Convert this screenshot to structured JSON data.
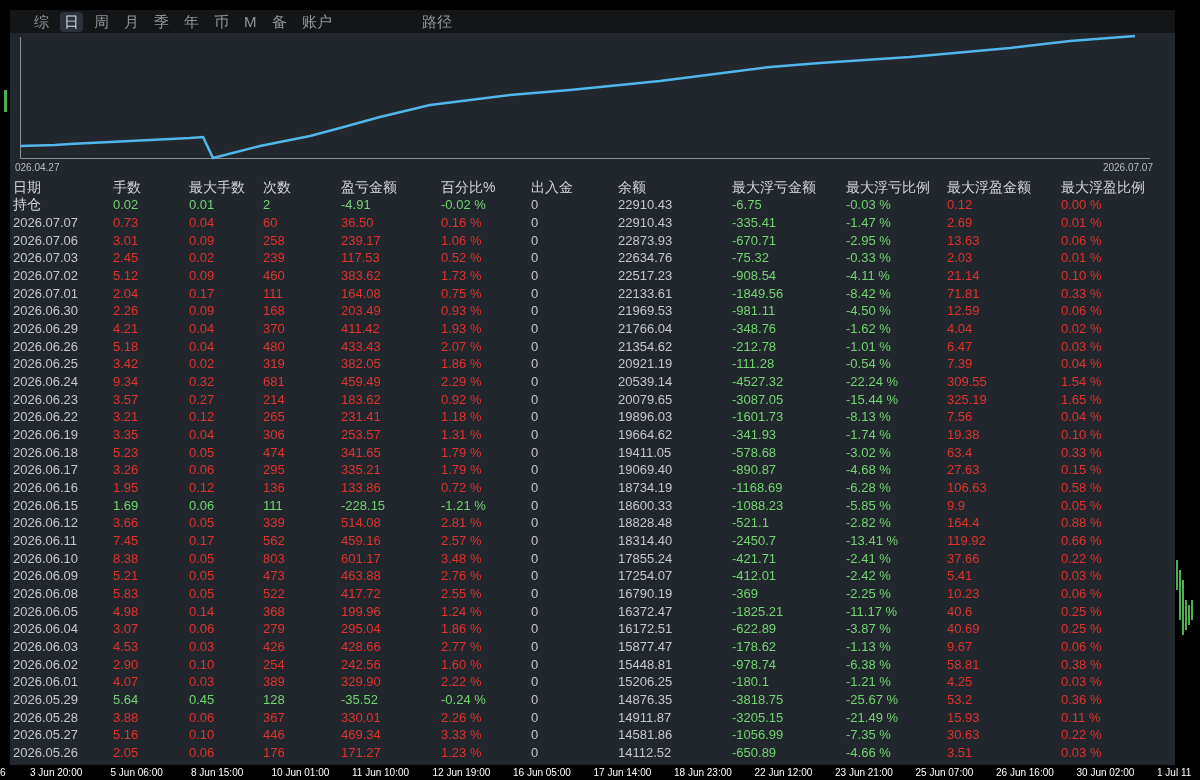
{
  "tabs": [
    {
      "label": "综",
      "selected": false
    },
    {
      "label": "日",
      "selected": true
    },
    {
      "label": "周",
      "selected": false
    },
    {
      "label": "月",
      "selected": false
    },
    {
      "label": "季",
      "selected": false
    },
    {
      "label": "年",
      "selected": false
    },
    {
      "label": "币",
      "selected": false
    },
    {
      "label": "M",
      "selected": false
    },
    {
      "label": "备",
      "selected": false
    },
    {
      "label": "账户",
      "selected": false
    }
  ],
  "path_button": "路径",
  "equity_chart": {
    "start_label": "026.04.27",
    "end_label": "2026.07.07"
  },
  "table": {
    "columns": [
      "日期",
      "手数",
      "最大手数",
      "次数",
      "盈亏金额",
      "百分比%",
      "出入金",
      "余额",
      "最大浮亏金额",
      "最大浮亏比例",
      "最大浮盈金额",
      "最大浮盈比例"
    ],
    "rows": [
      {
        "loss": true,
        "cells": [
          "持仓",
          "0.02",
          "0.01",
          "2",
          "-4.91",
          "-0.02 %",
          "0",
          "22910.43",
          "-6.75",
          "-0.03 %",
          "0.12",
          "0.00 %"
        ]
      },
      {
        "loss": false,
        "cells": [
          "2026.07.07",
          "0.73",
          "0.04",
          "60",
          "36.50",
          "0.16 %",
          "0",
          "22910.43",
          "-335.41",
          "-1.47 %",
          "2.69",
          "0.01 %"
        ]
      },
      {
        "loss": false,
        "cells": [
          "2026.07.06",
          "3.01",
          "0.09",
          "258",
          "239.17",
          "1.06 %",
          "0",
          "22873.93",
          "-670.71",
          "-2.95 %",
          "13.63",
          "0.06 %"
        ]
      },
      {
        "loss": false,
        "cells": [
          "2026.07.03",
          "2.45",
          "0.02",
          "239",
          "117.53",
          "0.52 %",
          "0",
          "22634.76",
          "-75.32",
          "-0.33 %",
          "2.03",
          "0.01 %"
        ]
      },
      {
        "loss": false,
        "cells": [
          "2026.07.02",
          "5.12",
          "0.09",
          "460",
          "383.62",
          "1.73 %",
          "0",
          "22517.23",
          "-908.54",
          "-4.11 %",
          "21.14",
          "0.10 %"
        ]
      },
      {
        "loss": false,
        "cells": [
          "2026.07.01",
          "2.04",
          "0.17",
          "111",
          "164.08",
          "0.75 %",
          "0",
          "22133.61",
          "-1849.56",
          "-8.42 %",
          "71.81",
          "0.33 %"
        ]
      },
      {
        "loss": false,
        "cells": [
          "2026.06.30",
          "2.26",
          "0.09",
          "168",
          "203.49",
          "0.93 %",
          "0",
          "21969.53",
          "-981.11",
          "-4.50 %",
          "12.59",
          "0.06 %"
        ]
      },
      {
        "loss": false,
        "cells": [
          "2026.06.29",
          "4.21",
          "0.04",
          "370",
          "411.42",
          "1.93 %",
          "0",
          "21766.04",
          "-348.76",
          "-1.62 %",
          "4.04",
          "0.02 %"
        ]
      },
      {
        "loss": false,
        "cells": [
          "2026.06.26",
          "5.18",
          "0.04",
          "480",
          "433.43",
          "2.07 %",
          "0",
          "21354.62",
          "-212.78",
          "-1.01 %",
          "6.47",
          "0.03 %"
        ]
      },
      {
        "loss": false,
        "cells": [
          "2026.06.25",
          "3.42",
          "0.02",
          "319",
          "382.05",
          "1.86 %",
          "0",
          "20921.19",
          "-111.28",
          "-0.54 %",
          "7.39",
          "0.04 %"
        ]
      },
      {
        "loss": false,
        "cells": [
          "2026.06.24",
          "9.34",
          "0.32",
          "681",
          "459.49",
          "2.29 %",
          "0",
          "20539.14",
          "-4527.32",
          "-22.24 %",
          "309.55",
          "1.54 %"
        ]
      },
      {
        "loss": false,
        "cells": [
          "2026.06.23",
          "3.57",
          "0.27",
          "214",
          "183.62",
          "0.92 %",
          "0",
          "20079.65",
          "-3087.05",
          "-15.44 %",
          "325.19",
          "1.65 %"
        ]
      },
      {
        "loss": false,
        "cells": [
          "2026.06.22",
          "3.21",
          "0.12",
          "265",
          "231.41",
          "1.18 %",
          "0",
          "19896.03",
          "-1601.73",
          "-8.13 %",
          "7.56",
          "0.04 %"
        ]
      },
      {
        "loss": false,
        "cells": [
          "2026.06.19",
          "3.35",
          "0.04",
          "306",
          "253.57",
          "1.31 %",
          "0",
          "19664.62",
          "-341.93",
          "-1.74 %",
          "19.38",
          "0.10 %"
        ]
      },
      {
        "loss": false,
        "cells": [
          "2026.06.18",
          "5.23",
          "0.05",
          "474",
          "341.65",
          "1.79 %",
          "0",
          "19411.05",
          "-578.68",
          "-3.02 %",
          "63.4",
          "0.33 %"
        ]
      },
      {
        "loss": false,
        "cells": [
          "2026.06.17",
          "3.26",
          "0.06",
          "295",
          "335.21",
          "1.79 %",
          "0",
          "19069.40",
          "-890.87",
          "-4.68 %",
          "27.63",
          "0.15 %"
        ]
      },
      {
        "loss": false,
        "cells": [
          "2026.06.16",
          "1.95",
          "0.12",
          "136",
          "133.86",
          "0.72 %",
          "0",
          "18734.19",
          "-1168.69",
          "-6.28 %",
          "106.63",
          "0.58 %"
        ]
      },
      {
        "loss": true,
        "cells": [
          "2026.06.15",
          "1.69",
          "0.06",
          "111",
          "-228.15",
          "-1.21 %",
          "0",
          "18600.33",
          "-1088.23",
          "-5.85 %",
          "9.9",
          "0.05 %"
        ]
      },
      {
        "loss": false,
        "cells": [
          "2026.06.12",
          "3.66",
          "0.05",
          "339",
          "514.08",
          "2.81 %",
          "0",
          "18828.48",
          "-521.1",
          "-2.82 %",
          "164.4",
          "0.88 %"
        ]
      },
      {
        "loss": false,
        "cells": [
          "2026.06.11",
          "7.45",
          "0.17",
          "562",
          "459.16",
          "2.57 %",
          "0",
          "18314.40",
          "-2450.7",
          "-13.41 %",
          "119.92",
          "0.66 %"
        ]
      },
      {
        "loss": false,
        "cells": [
          "2026.06.10",
          "8.38",
          "0.05",
          "803",
          "601.17",
          "3.48 %",
          "0",
          "17855.24",
          "-421.71",
          "-2.41 %",
          "37.66",
          "0.22 %"
        ]
      },
      {
        "loss": false,
        "cells": [
          "2026.06.09",
          "5.21",
          "0.05",
          "473",
          "463.88",
          "2.76 %",
          "0",
          "17254.07",
          "-412.01",
          "-2.42 %",
          "5.41",
          "0.03 %"
        ]
      },
      {
        "loss": false,
        "cells": [
          "2026.06.08",
          "5.83",
          "0.05",
          "522",
          "417.72",
          "2.55 %",
          "0",
          "16790.19",
          "-369",
          "-2.25 %",
          "10.23",
          "0.06 %"
        ]
      },
      {
        "loss": false,
        "cells": [
          "2026.06.05",
          "4.98",
          "0.14",
          "368",
          "199.96",
          "1.24 %",
          "0",
          "16372.47",
          "-1825.21",
          "-11.17 %",
          "40.6",
          "0.25 %"
        ]
      },
      {
        "loss": false,
        "cells": [
          "2026.06.04",
          "3.07",
          "0.06",
          "279",
          "295.04",
          "1.86 %",
          "0",
          "16172.51",
          "-622.89",
          "-3.87 %",
          "40.69",
          "0.25 %"
        ]
      },
      {
        "loss": false,
        "cells": [
          "2026.06.03",
          "4.53",
          "0.03",
          "426",
          "428.66",
          "2.77 %",
          "0",
          "15877.47",
          "-178.62",
          "-1.13 %",
          "9.67",
          "0.06 %"
        ]
      },
      {
        "loss": false,
        "cells": [
          "2026.06.02",
          "2.90",
          "0.10",
          "254",
          "242.56",
          "1.60 %",
          "0",
          "15448.81",
          "-978.74",
          "-6.38 %",
          "58.81",
          "0.38 %"
        ]
      },
      {
        "loss": false,
        "cells": [
          "2026.06.01",
          "4.07",
          "0.03",
          "389",
          "329.90",
          "2.22 %",
          "0",
          "15206.25",
          "-180.1",
          "-1.21 %",
          "4.25",
          "0.03 %"
        ]
      },
      {
        "loss": true,
        "cells": [
          "2026.05.29",
          "5.64",
          "0.45",
          "128",
          "-35.52",
          "-0.24 %",
          "0",
          "14876.35",
          "-3818.75",
          "-25.67 %",
          "53.2",
          "0.36 %"
        ]
      },
      {
        "loss": false,
        "cells": [
          "2026.05.28",
          "3.88",
          "0.06",
          "367",
          "330.01",
          "2.26 %",
          "0",
          "14911.87",
          "-3205.15",
          "-21.49 %",
          "15.93",
          "0.11 %"
        ]
      },
      {
        "loss": false,
        "cells": [
          "2026.05.27",
          "5.16",
          "0.10",
          "446",
          "469.34",
          "3.33 %",
          "0",
          "14581.86",
          "-1056.99",
          "-7.35 %",
          "30.63",
          "0.22 %"
        ]
      },
      {
        "loss": false,
        "cells": [
          "2026.05.26",
          "2.05",
          "0.06",
          "176",
          "171.27",
          "1.23 %",
          "0",
          "14112.52",
          "-650.89",
          "-4.66 %",
          "3.51",
          "0.03 %"
        ]
      }
    ]
  },
  "time_axis": [
    "6",
    "3 Jun 20:00",
    "5 Jun 06:00",
    "8 Jun 15:00",
    "10 Jun 01:00",
    "11 Jun 10:00",
    "12 Jun 19:00",
    "16 Jun 05:00",
    "17 Jun 14:00",
    "18 Jun 23:00",
    "22 Jun 12:00",
    "23 Jun 21:00",
    "25 Jun 07:00",
    "26 Jun 16:00",
    "30 Jun 02:00",
    "1 Jul 11"
  ]
}
